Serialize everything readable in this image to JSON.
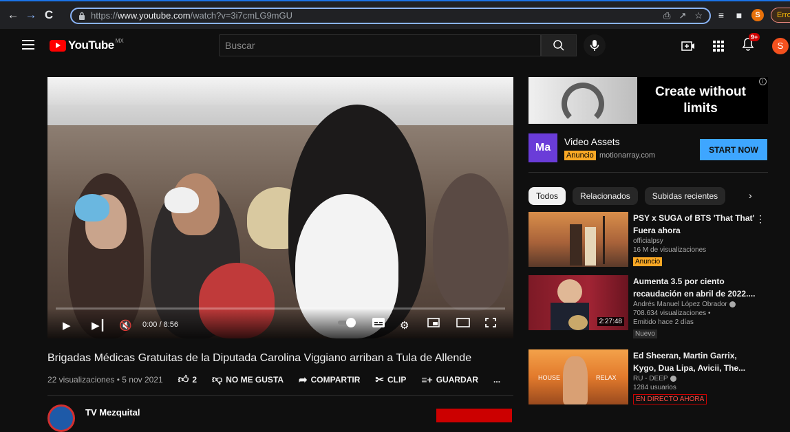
{
  "browser": {
    "url_scheme": "https://",
    "url_host": "www.youtube.com",
    "url_path": "/watch?v=3i7cmLG9mGU",
    "profile_initial": "S",
    "error_label": "Erro"
  },
  "masthead": {
    "logo_text": "YouTube",
    "country_code": "MX",
    "search_placeholder": "Buscar",
    "notifications_count": "9+",
    "avatar_initial": "S"
  },
  "player": {
    "timecode": "0:00 / 8:56"
  },
  "video": {
    "title": "Brigadas Médicas Gratuitas de la Diputada Carolina Viggiano arriban a Tula de Allende",
    "stats": "22 visualizaciones • 5 nov 2021",
    "likes": "2",
    "dislike_label": "NO ME GUSTA",
    "share_label": "COMPARTIR",
    "clip_label": "CLIP",
    "save_label": "GUARDAR",
    "more_label": "...",
    "channel_name": "TV Mezquital"
  },
  "ad": {
    "banner_text": "Create without limits",
    "logo_text": "Ma",
    "title": "Video Assets",
    "badge": "Anuncio",
    "domain": "motionarray.com",
    "cta": "START NOW",
    "info": "i"
  },
  "chips": [
    "Todos",
    "Relacionados",
    "Subidas recientes"
  ],
  "recommendations": [
    {
      "title": "PSY x SUGA of BTS 'That That' Fuera ahora",
      "channel": "officialpsy",
      "views": "16 M de visualizaciones",
      "tag": "Anuncio"
    },
    {
      "title": "Aumenta 3.5 por ciento recaudación en abril de 2022....",
      "channel": "Andrés Manuel López Obrador",
      "views": "708.634 visualizaciones •",
      "age": "Emitido hace 2 días",
      "tag": "Nuevo",
      "duration": "2:27:48"
    },
    {
      "title": "Ed Sheeran, Martin Garrix, Kygo, Dua Lipa, Avicii, The...",
      "channel": "RU - DEEP",
      "views": "1284 usuarios",
      "tag": "EN DIRECTO AHORA",
      "thumb_left": "HOUSE",
      "thumb_right": "RELAX"
    }
  ]
}
